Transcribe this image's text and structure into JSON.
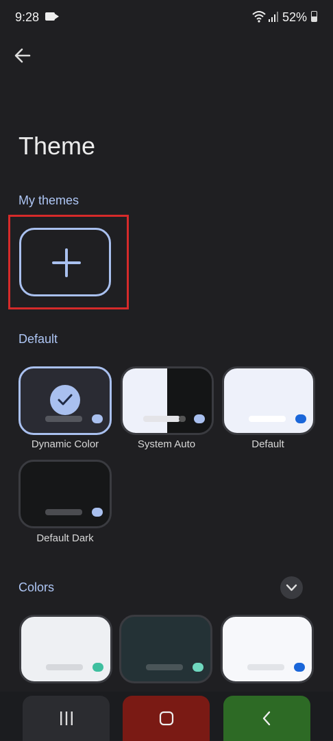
{
  "status_bar": {
    "time": "9:28",
    "battery": "52%"
  },
  "page": {
    "title": "Theme"
  },
  "sections": {
    "my_themes": "My themes",
    "default": "Default",
    "colors": "Colors"
  },
  "default_themes": [
    {
      "label": "Dynamic Color",
      "selected": true
    },
    {
      "label": "System Auto",
      "selected": false
    },
    {
      "label": "Default",
      "selected": false
    },
    {
      "label": "Default Dark",
      "selected": false
    }
  ],
  "colors": {
    "background": "#1f1f22",
    "accent": "#a9c0ef",
    "highlight_box": "#d62a2a",
    "teal_dot": "#3fbf9f",
    "blue_dot": "#1a66d9"
  },
  "icons": {
    "back": "arrow-left-icon",
    "add": "plus-icon",
    "check": "check-icon",
    "collapse": "chevron-down-icon",
    "nav_recents": "recents-icon",
    "nav_home": "home-icon",
    "nav_back": "chevron-left-icon"
  }
}
